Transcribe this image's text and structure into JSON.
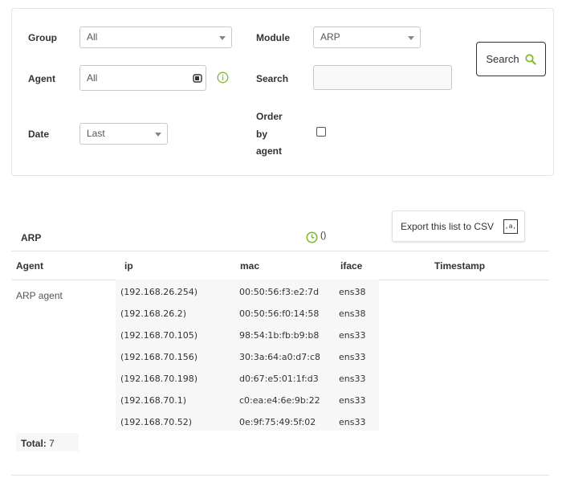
{
  "filters": {
    "group_label": "Group",
    "group_value": "All",
    "module_label": "Module",
    "module_value": "ARP",
    "agent_label": "Agent",
    "agent_value": "All",
    "search_label": "Search",
    "search_value": "",
    "date_label": "Date",
    "date_value": "Last",
    "order_label_1": "Order",
    "order_label_2": "by",
    "order_label_3": "agent",
    "order_checked": false,
    "search_button": "Search"
  },
  "results": {
    "module_title": "ARP",
    "period_text": "()",
    "export_button": "Export this list to CSV",
    "columns": [
      "Agent",
      "ip",
      "mac",
      "iface",
      "Timestamp"
    ],
    "agent_name": "ARP agent",
    "rows": [
      {
        "ip": "(192.168.26.254)",
        "mac": "00:50:56:f3:e2:7d",
        "iface": "ens38"
      },
      {
        "ip": "(192.168.26.2)",
        "mac": "00:50:56:f0:14:58",
        "iface": "ens38"
      },
      {
        "ip": "(192.168.70.105)",
        "mac": "98:54:1b:fb:b9:b8",
        "iface": "ens33"
      },
      {
        "ip": "(192.168.70.156)",
        "mac": "30:3a:64:a0:d7:c8",
        "iface": "ens33"
      },
      {
        "ip": "(192.168.70.198)",
        "mac": "d0:67:e5:01:1f:d3",
        "iface": "ens33"
      },
      {
        "ip": "(192.168.70.1)",
        "mac": "c0:ea:e4:6e:9b:22",
        "iface": "ens33"
      },
      {
        "ip": "(192.168.70.52)",
        "mac": "0e:9f:75:49:5f:02",
        "iface": "ens33"
      }
    ],
    "total_label": "Total:",
    "total_value": "7"
  },
  "colors": {
    "accent": "#82b92e",
    "border": "#e2e2e2"
  },
  "icons": {
    "search": "search-icon",
    "info": "info-icon",
    "agent_picker": "agent-picker-icon",
    "clock": "clock-icon",
    "csv": "csv-icon"
  }
}
